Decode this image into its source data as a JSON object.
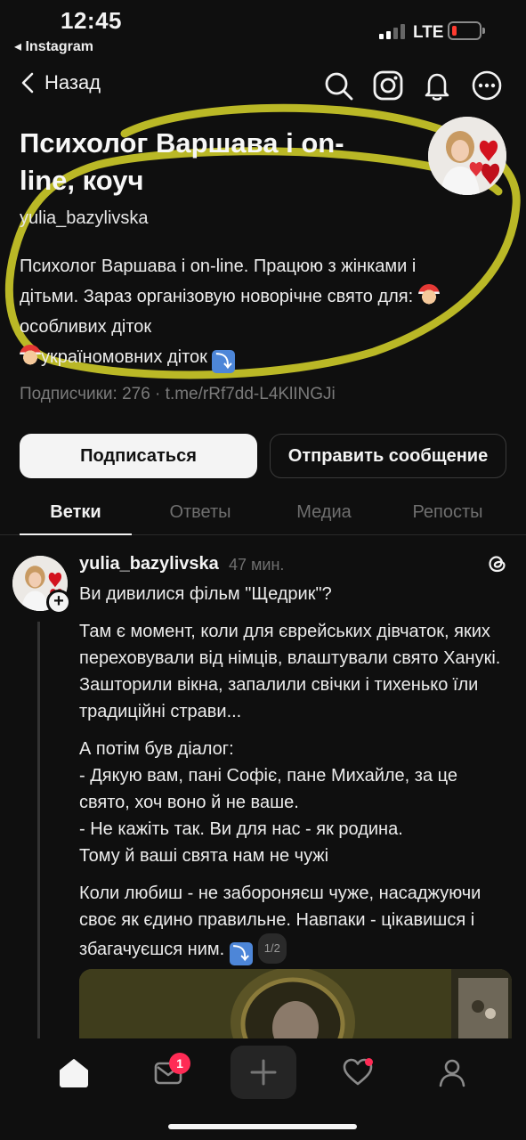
{
  "status_bar": {
    "time": "12:45",
    "back_app": "◂ Instagram",
    "network": "LTE",
    "battery_level": 0.15
  },
  "nav": {
    "back_label": "Назад",
    "icons": [
      "search-icon",
      "instagram-icon",
      "bell-icon",
      "more-icon"
    ]
  },
  "profile": {
    "name_line1": "Психолог Варшава і on-",
    "name_line2": "line, коуч",
    "username": "yulia_bazylivska",
    "bio_line1": "Психолог Варшава і on-line. Працюю з жінками і",
    "bio_line2": "дітьми. Зараз організовую новорічне свято для:",
    "bio_line3": "особливих діток",
    "bio_line4": "україномовних діток",
    "followers_line": "Подписчики: 276 · t.me/rRf7dd-L4KlINGJi"
  },
  "actions": {
    "follow": "Подписаться",
    "message": "Отправить сообщение"
  },
  "tabs": [
    {
      "label": "Ветки",
      "active": true
    },
    {
      "label": "Ответы",
      "active": false
    },
    {
      "label": "Медиа",
      "active": false
    },
    {
      "label": "Репосты",
      "active": false
    }
  ],
  "post": {
    "author": "yulia_bazylivska",
    "time_ago": "47 мин.",
    "line1": "Ви дивилися фільм \"Щедрик\"?",
    "para1": "Там є момент, коли для єврейських дівчаток, яких переховували від німців, влаштували свято Ханукі. Зашторили вікна, запалили свічки  і тихенько їли традиційні страви...",
    "para2_1": "А потім був діалог:",
    "para2_2": "- Дякую вам, пані Софіє, пане Михайле, за це свято, хоч воно й не ваше.",
    "para2_3": "- Не кажіть так. Ви для нас - як родина.",
    "para2_4": "Тому й ваші свята нам не чужі",
    "para3": "Коли любиш - не забороняєш чуже, насаджуючи своє як єдино правильне. Навпаки - цікавишся і збагачуєшся ним.",
    "pager": "1/2"
  },
  "bottom_nav": {
    "inbox_badge": "1",
    "icons": [
      "home-icon",
      "inbox-icon",
      "plus-icon",
      "heart-icon",
      "profile-icon"
    ]
  },
  "colors": {
    "background": "#0f0f0f",
    "accent_badge": "#ff2b55",
    "annotation_highlight": "#d8d62a"
  }
}
